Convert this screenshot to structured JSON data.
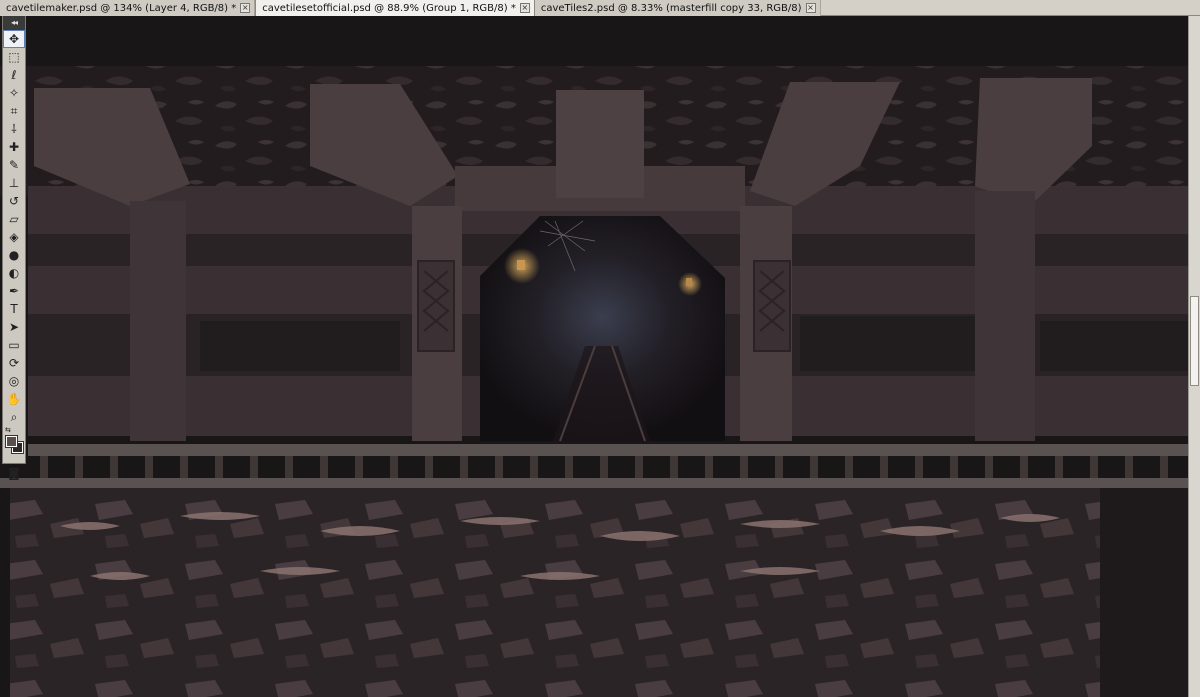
{
  "tabs": [
    {
      "label": "cavetilemaker.psd @ 134% (Layer 4, RGB/8) *",
      "active": false
    },
    {
      "label": "cavetilesetofficial.psd @ 88.9% (Group 1, RGB/8) *",
      "active": true
    },
    {
      "label": "caveTiles2.psd @ 8.33% (masterfill copy 33, RGB/8)",
      "active": false
    }
  ],
  "tab_close_glyph": "×",
  "tools": {
    "grip_glyph": "◂◂",
    "items": [
      {
        "icon": "move-icon",
        "glyph": "✥"
      },
      {
        "icon": "marquee-icon",
        "glyph": "⬚"
      },
      {
        "icon": "lasso-icon",
        "glyph": "ℓ"
      },
      {
        "icon": "magic-wand-icon",
        "glyph": "✧"
      },
      {
        "icon": "crop-icon",
        "glyph": "⌗"
      },
      {
        "icon": "eyedropper-icon",
        "glyph": "⸸"
      },
      {
        "icon": "healing-brush-icon",
        "glyph": "✚"
      },
      {
        "icon": "brush-icon",
        "glyph": "✎"
      },
      {
        "icon": "clone-stamp-icon",
        "glyph": "⊥"
      },
      {
        "icon": "history-brush-icon",
        "glyph": "↺"
      },
      {
        "icon": "eraser-icon",
        "glyph": "▱"
      },
      {
        "icon": "paint-bucket-icon",
        "glyph": "◈"
      },
      {
        "icon": "blur-icon",
        "glyph": "●"
      },
      {
        "icon": "dodge-icon",
        "glyph": "◐"
      },
      {
        "icon": "pen-icon",
        "glyph": "✒"
      },
      {
        "icon": "type-icon",
        "glyph": "T"
      },
      {
        "icon": "path-selection-icon",
        "glyph": "➤"
      },
      {
        "icon": "rectangle-shape-icon",
        "glyph": "▭"
      },
      {
        "icon": "3d-rotate-icon",
        "glyph": "⟳"
      },
      {
        "icon": "3d-orbit-icon",
        "glyph": "◎"
      },
      {
        "icon": "hand-icon",
        "glyph": "✋"
      },
      {
        "icon": "zoom-icon",
        "glyph": "⌕"
      }
    ],
    "quick_mask_glyph": "◙",
    "swap_glyph": "⇆"
  },
  "colors": {
    "foreground": "#5a4e4b",
    "background": "#2d2624"
  }
}
